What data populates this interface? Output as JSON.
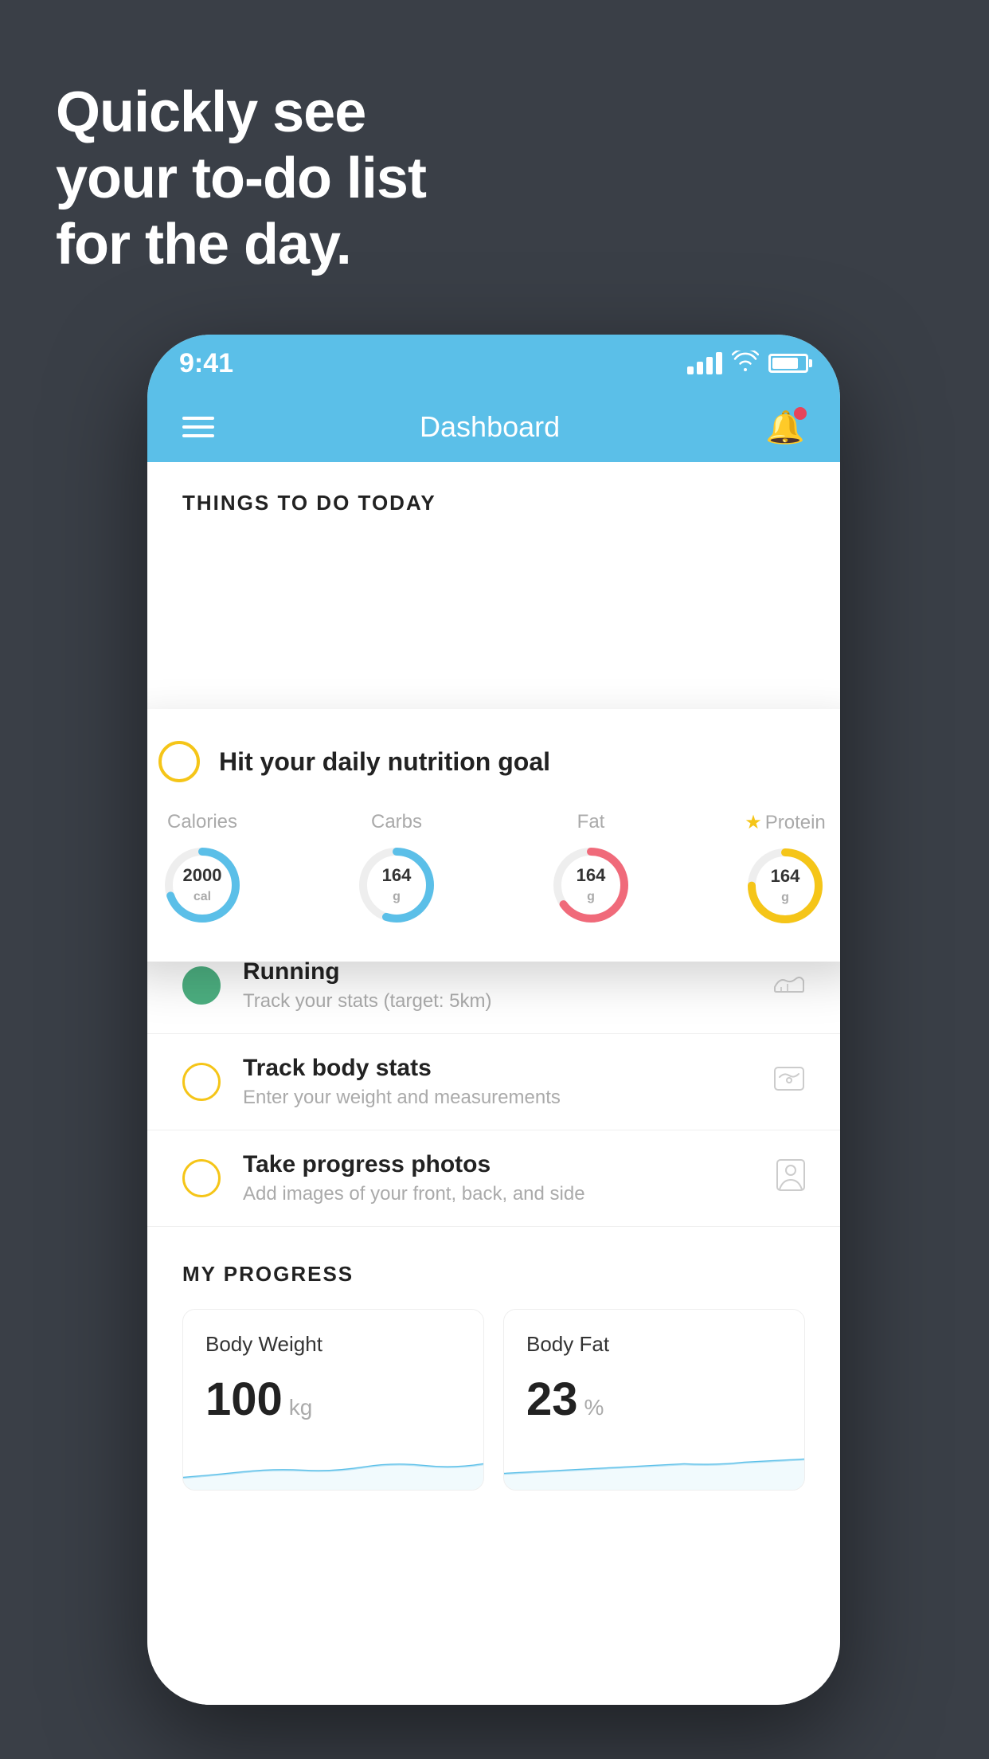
{
  "headline": {
    "line1": "Quickly see",
    "line2": "your to-do list",
    "line3": "for the day."
  },
  "phone": {
    "status_bar": {
      "time": "9:41"
    },
    "nav": {
      "title": "Dashboard"
    },
    "floating_card": {
      "circle_color": "#f5c518",
      "title": "Hit your daily nutrition goal",
      "nutrition": [
        {
          "label": "Calories",
          "value": "2000",
          "unit": "cal",
          "color": "#5bbfe8",
          "percent": 70
        },
        {
          "label": "Carbs",
          "value": "164",
          "unit": "g",
          "color": "#5bbfe8",
          "percent": 55
        },
        {
          "label": "Fat",
          "value": "164",
          "unit": "g",
          "color": "#f06a7a",
          "percent": 65
        },
        {
          "label": "Protein",
          "value": "164",
          "unit": "g",
          "color": "#f5c518",
          "percent": 75,
          "starred": true
        }
      ]
    },
    "things_section_label": "THINGS TO DO TODAY",
    "todo_items": [
      {
        "id": "running",
        "circle_type": "green",
        "title": "Running",
        "subtitle": "Track your stats (target: 5km)",
        "icon": "shoe"
      },
      {
        "id": "body-stats",
        "circle_type": "yellow",
        "title": "Track body stats",
        "subtitle": "Enter your weight and measurements",
        "icon": "scale"
      },
      {
        "id": "progress-photos",
        "circle_type": "yellow",
        "title": "Take progress photos",
        "subtitle": "Add images of your front, back, and side",
        "icon": "person"
      }
    ],
    "progress_section_label": "MY PROGRESS",
    "progress_cards": [
      {
        "id": "body-weight",
        "label": "Body Weight",
        "value": "100",
        "unit": "kg"
      },
      {
        "id": "body-fat",
        "label": "Body Fat",
        "value": "23",
        "unit": "%"
      }
    ]
  }
}
